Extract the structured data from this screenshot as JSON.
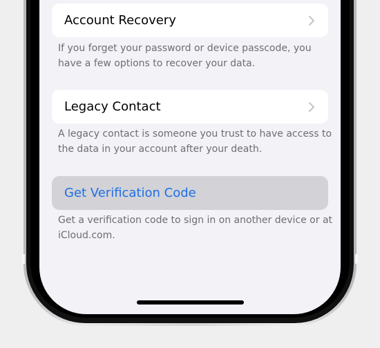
{
  "settings": {
    "account_recovery": {
      "label": "Account Recovery",
      "footer": "If you forget your password or device passcode, you have a few options to recover your data."
    },
    "legacy_contact": {
      "label": "Legacy Contact",
      "footer": "A legacy contact is someone you trust to have access to the data in your account after your death."
    },
    "verification": {
      "label": "Get Verification Code",
      "footer": "Get a verification code to sign in on another device or at iCloud.com."
    }
  },
  "icons": {
    "row_chevron": "chevron-right-icon"
  },
  "colors": {
    "screen_background": "#f2f2f7",
    "cell_background": "#ffffff",
    "highlighted_cell": "#d2d2d7",
    "link_blue": "#1f6fe5",
    "footnote_gray": "#6d6d72"
  }
}
